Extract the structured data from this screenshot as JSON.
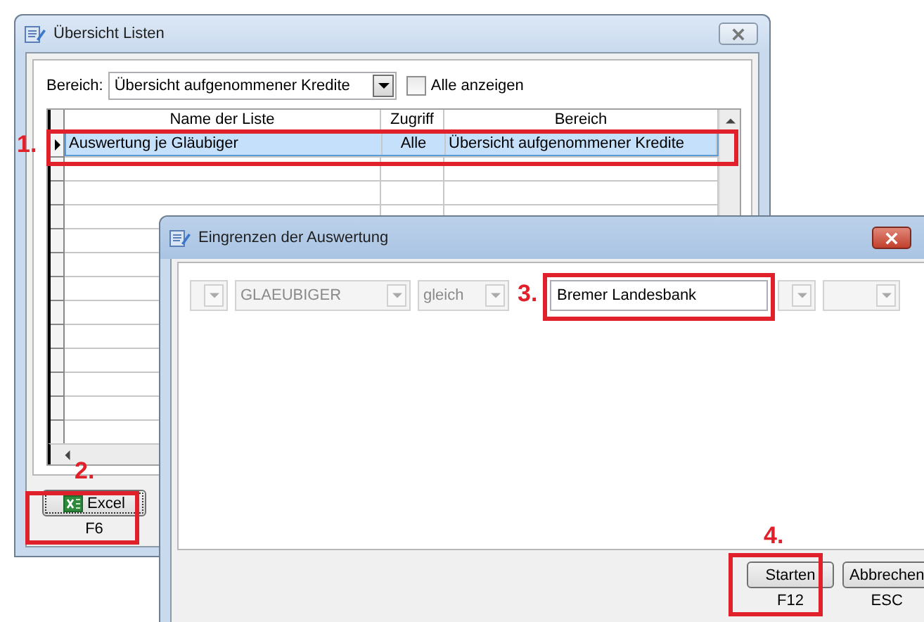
{
  "list_window": {
    "title": "Übersicht Listen",
    "bereich_label": "Bereich:",
    "bereich_value": "Übersicht aufgenommener Kredite",
    "show_all": {
      "label": "Alle anzeigen",
      "checked": false
    },
    "table": {
      "columns": [
        "Name der Liste",
        "Zugriff",
        "Bereich"
      ],
      "rows": [
        {
          "cells": [
            "Auswertung je Gläubiger",
            "Alle",
            "Übersicht aufgenommener Kredite"
          ],
          "selected": true
        }
      ]
    },
    "excel_button": {
      "label": "Excel",
      "shortcut": "F6"
    }
  },
  "filter_window": {
    "title": "Eingrenzen der Auswertung",
    "filters": [
      {
        "kind": "combo",
        "disabled": true
      },
      {
        "kind": "combo",
        "value": "GLAEUBIGER",
        "disabled": true
      },
      {
        "kind": "combo",
        "value": "gleich",
        "disabled": true
      },
      {
        "kind": "text",
        "value": "Bremer Landesbank"
      },
      {
        "kind": "combo",
        "disabled": true
      },
      {
        "kind": "combo",
        "disabled": true
      }
    ],
    "buttons": [
      {
        "label": "Starten",
        "shortcut": "F12"
      },
      {
        "label": "Abbrechen",
        "shortcut": "ESC"
      }
    ]
  },
  "annotations": [
    "1.",
    "2.",
    "3.",
    "4."
  ]
}
